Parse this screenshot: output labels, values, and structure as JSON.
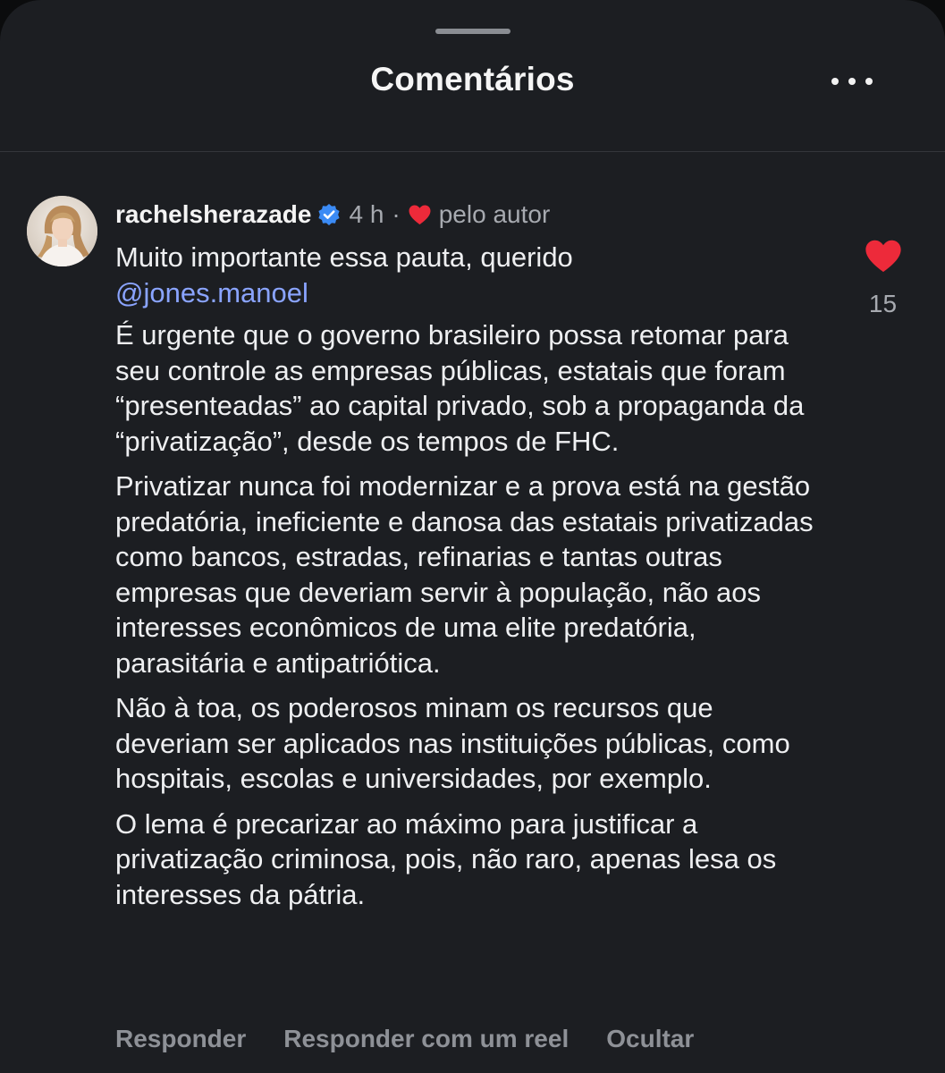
{
  "header": {
    "title": "Comentários",
    "more_icon": "more-horizontal-icon"
  },
  "comment": {
    "username": "rachelsherazade",
    "verified_icon": "verified-badge-icon",
    "time": "4 h",
    "separator": "·",
    "liked_by_author_icon": "heart-filled-icon",
    "liked_by_author": "pelo autor",
    "first_line": "Muito importante essa pauta, querido",
    "mention": "@jones.manoel",
    "paragraphs": [
      "É urgente que o governo brasileiro possa retomar para seu controle as empresas públicas, estatais que foram “presenteadas” ao capital privado, sob a propaganda da “privatização”, desde os tempos de FHC.",
      "Privatizar nunca foi modernizar e a prova está na gestão predatória, ineficiente e danosa das estatais privatizadas como bancos, estradas, refinarias e tantas outras empresas que deveriam servir à população, não aos interesses econômicos de uma elite predatória, parasitária e antipatriótica.",
      "Não à toa, os poderosos minam os recursos que deveriam ser aplicados nas instituições  públicas, como hospitais, escolas e universidades, por exemplo.",
      "O lema é precarizar ao máximo para justificar a privatização criminosa, pois, não raro, apenas lesa os interesses da pátria."
    ],
    "like_icon": "heart-filled-icon",
    "like_count": "15",
    "actions": {
      "reply": "Responder",
      "reply_reel": "Responder com um reel",
      "hide": "Ocultar"
    }
  },
  "colors": {
    "background": "#1c1e22",
    "mention": "#8aa4ff",
    "heart": "#ed2a3a",
    "verified": "#3b8bf5",
    "secondary_text": "#a7aab0"
  }
}
